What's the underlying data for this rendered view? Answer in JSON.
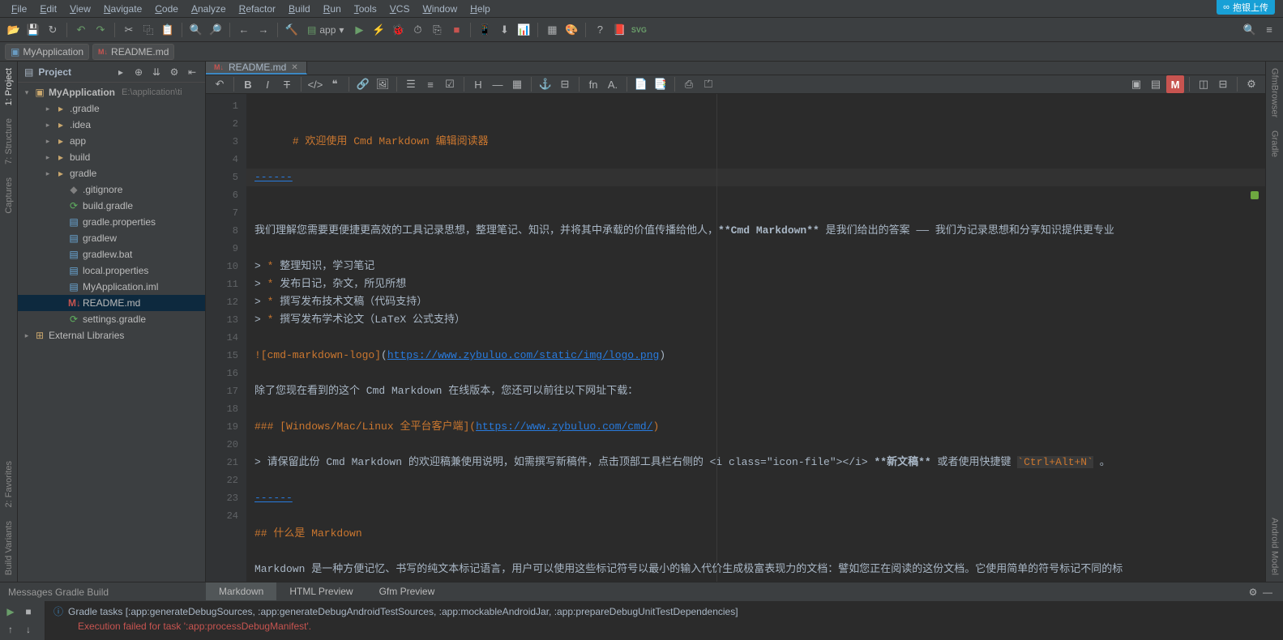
{
  "menubar": [
    "File",
    "Edit",
    "View",
    "Navigate",
    "Code",
    "Analyze",
    "Refactor",
    "Build",
    "Run",
    "Tools",
    "VCS",
    "Window",
    "Help"
  ],
  "upload_button": "抱银上传",
  "toolbar": {
    "run_config": "app"
  },
  "navbar": {
    "crumb1": "MyApplication",
    "crumb2": "README.md"
  },
  "project": {
    "title": "Project",
    "root_name": "MyApplication",
    "root_path": "E:\\application\\ti",
    "nodes": [
      {
        "indent": 2,
        "arrow": "▸",
        "icon": "folder",
        "label": ".gradle"
      },
      {
        "indent": 2,
        "arrow": "▸",
        "icon": "folder",
        "label": ".idea"
      },
      {
        "indent": 2,
        "arrow": "▸",
        "icon": "app-folder",
        "label": "app"
      },
      {
        "indent": 2,
        "arrow": "▸",
        "icon": "folder",
        "label": "build"
      },
      {
        "indent": 2,
        "arrow": "▸",
        "icon": "folder",
        "label": "gradle"
      },
      {
        "indent": 3,
        "arrow": "",
        "icon": "git",
        "label": ".gitignore"
      },
      {
        "indent": 3,
        "arrow": "",
        "icon": "gradle",
        "label": "build.gradle"
      },
      {
        "indent": 3,
        "arrow": "",
        "icon": "file",
        "label": "gradle.properties"
      },
      {
        "indent": 3,
        "arrow": "",
        "icon": "file",
        "label": "gradlew"
      },
      {
        "indent": 3,
        "arrow": "",
        "icon": "file",
        "label": "gradlew.bat"
      },
      {
        "indent": 3,
        "arrow": "",
        "icon": "file",
        "label": "local.properties"
      },
      {
        "indent": 3,
        "arrow": "",
        "icon": "file",
        "label": "MyApplication.iml"
      },
      {
        "indent": 3,
        "arrow": "",
        "icon": "md",
        "label": "README.md",
        "selected": true
      },
      {
        "indent": 3,
        "arrow": "",
        "icon": "gradle",
        "label": "settings.gradle"
      }
    ],
    "external_libs": "External Libraries"
  },
  "left_tabs": [
    "1: Project",
    "7: Structure",
    "Captures",
    "2: Favorites",
    "Build Variants"
  ],
  "right_tabs": [
    "GfmBrowser",
    "Gradle",
    "Android Model"
  ],
  "editor": {
    "tab_label": "README.md",
    "lines": [
      {
        "n": 1,
        "c": [
          {
            "t": "# ",
            "cls": "keyword"
          },
          {
            "t": "欢迎使用 Cmd Markdown 编辑阅读器",
            "cls": "keyword"
          }
        ]
      },
      {
        "n": 2,
        "c": [
          {
            "t": "",
            "cls": ""
          }
        ]
      },
      {
        "n": 3,
        "hl": true,
        "c": [
          {
            "t": "------",
            "cls": "hr-dash"
          }
        ]
      },
      {
        "n": 4,
        "c": [
          {
            "t": "",
            "cls": ""
          }
        ]
      },
      {
        "n": 5,
        "c": [
          {
            "t": "我们理解您需要更便捷更高效的工具记录思想，整理笔记、知识，并将其中承载的价值传播给他人，",
            "cls": ""
          },
          {
            "t": "**Cmd Markdown**",
            "cls": "bold"
          },
          {
            "t": " 是我们给出的答案 —— 我们为记录思想和分享知识提供更专业",
            "cls": ""
          }
        ]
      },
      {
        "n": 6,
        "c": [
          {
            "t": "",
            "cls": ""
          }
        ]
      },
      {
        "n": 7,
        "c": [
          {
            "t": "> ",
            "cls": ""
          },
          {
            "t": "*",
            "cls": "keyword"
          },
          {
            "t": " 整理知识，学习笔记",
            "cls": ""
          }
        ]
      },
      {
        "n": 8,
        "c": [
          {
            "t": "> ",
            "cls": ""
          },
          {
            "t": "*",
            "cls": "keyword"
          },
          {
            "t": " 发布日记，杂文，所见所想",
            "cls": ""
          }
        ]
      },
      {
        "n": 9,
        "c": [
          {
            "t": "> ",
            "cls": ""
          },
          {
            "t": "*",
            "cls": "keyword"
          },
          {
            "t": " 撰写发布技术文稿（代码支持）",
            "cls": ""
          }
        ]
      },
      {
        "n": 10,
        "c": [
          {
            "t": "> ",
            "cls": ""
          },
          {
            "t": "*",
            "cls": "keyword"
          },
          {
            "t": " 撰写发布学术论文（LaTeX 公式支持）",
            "cls": ""
          }
        ]
      },
      {
        "n": 11,
        "c": [
          {
            "t": "",
            "cls": ""
          }
        ]
      },
      {
        "n": 12,
        "c": [
          {
            "t": "![cmd-markdown-logo]",
            "cls": "keyword"
          },
          {
            "t": "(",
            "cls": ""
          },
          {
            "t": "https://www.zybuluo.com/static/img/logo.png",
            "cls": "link"
          },
          {
            "t": ")",
            "cls": ""
          }
        ]
      },
      {
        "n": 13,
        "c": [
          {
            "t": "",
            "cls": ""
          }
        ]
      },
      {
        "n": 14,
        "c": [
          {
            "t": "除了您现在看到的这个 Cmd Markdown 在线版本，您还可以前往以下网址下载：",
            "cls": ""
          }
        ]
      },
      {
        "n": 15,
        "c": [
          {
            "t": "",
            "cls": ""
          }
        ]
      },
      {
        "n": 16,
        "c": [
          {
            "t": "### ",
            "cls": "keyword"
          },
          {
            "t": "[Windows/Mac/Linux 全平台客户端]",
            "cls": "keyword"
          },
          {
            "t": "(",
            "cls": "keyword"
          },
          {
            "t": "https://www.zybuluo.com/cmd/",
            "cls": "link"
          },
          {
            "t": ")",
            "cls": "keyword"
          }
        ]
      },
      {
        "n": 17,
        "c": [
          {
            "t": "",
            "cls": ""
          }
        ]
      },
      {
        "n": 18,
        "c": [
          {
            "t": "> 请保留此份 Cmd Markdown 的欢迎稿兼使用说明，如需撰写新稿件，点击顶部工具栏右侧的 <i class=\"icon-file\"></i> ",
            "cls": ""
          },
          {
            "t": "**新文稿**",
            "cls": "bold"
          },
          {
            "t": " 或者使用快捷键 ",
            "cls": ""
          },
          {
            "t": "`Ctrl+Alt+N`",
            "cls": "code-inline"
          },
          {
            "t": " 。",
            "cls": ""
          }
        ]
      },
      {
        "n": 19,
        "c": [
          {
            "t": "",
            "cls": ""
          }
        ]
      },
      {
        "n": 20,
        "c": [
          {
            "t": "------",
            "cls": "hr-dash"
          }
        ]
      },
      {
        "n": 21,
        "c": [
          {
            "t": "",
            "cls": ""
          }
        ]
      },
      {
        "n": 22,
        "c": [
          {
            "t": "## ",
            "cls": "keyword"
          },
          {
            "t": "什么是 Markdown",
            "cls": "keyword"
          }
        ]
      },
      {
        "n": 23,
        "c": [
          {
            "t": "",
            "cls": ""
          }
        ]
      },
      {
        "n": 24,
        "c": [
          {
            "t": "Markdown 是一种方便记忆、书写的纯文本标记语言，用户可以使用这些标记符号以最小的输入代价生成极富表现力的文档：譬如您正在阅读的这份文档。它使用简单的符号标记不同的标",
            "cls": ""
          }
        ]
      }
    ],
    "bottom_tabs": [
      "Markdown",
      "HTML Preview",
      "Gfm Preview"
    ]
  },
  "messages": {
    "header": "Messages Gradle Build",
    "line1": "Gradle tasks [:app:generateDebugSources, :app:generateDebugAndroidTestSources, :app:mockableAndroidJar, :app:prepareDebugUnitTestDependencies]",
    "line2": "Execution failed for task ':app:processDebugManifest'."
  }
}
